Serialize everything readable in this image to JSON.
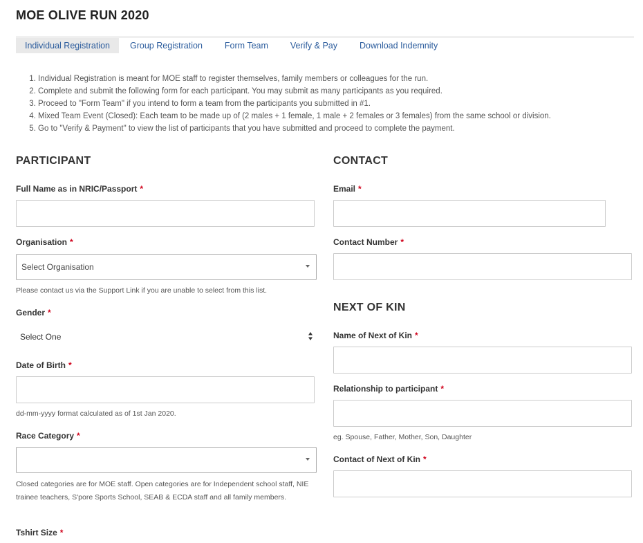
{
  "header": {
    "title": "MOE OLIVE RUN 2020"
  },
  "tabs": [
    {
      "label": "Individual Registration",
      "active": true
    },
    {
      "label": "Group Registration",
      "active": false
    },
    {
      "label": "Form Team",
      "active": false
    },
    {
      "label": "Verify & Pay",
      "active": false
    },
    {
      "label": "Download Indemnity",
      "active": false
    }
  ],
  "instructions": [
    "Individual Registration is meant for MOE staff to register themselves, family members or colleagues for the run.",
    "Complete and submit the following form for each participant. You may submit as many participants as you required.",
    "Proceed to \"Form Team\" if you intend to form a team from the participants you submitted in #1.",
    "Mixed Team Event (Closed): Each team to be made up of (2 males + 1 female, 1 male + 2 females or 3 females) from the same school or division.",
    "Go to \"Verify & Payment\" to view the list of participants that you have submitted  and proceed to complete the payment."
  ],
  "participant": {
    "title": "PARTICIPANT",
    "full_name_label": "Full Name as in NRIC/Passport",
    "organisation_label": "Organisation",
    "organisation_value": "Select Organisation",
    "organisation_hint": "Please contact us via the Support Link if you are unable to select from this list.",
    "gender_label": "Gender",
    "gender_value": "Select One",
    "dob_label": "Date of Birth",
    "dob_hint": "dd-mm-yyyy format calculated as of 1st Jan 2020.",
    "race_label": "Race Category",
    "race_value": "",
    "race_hint": "Closed categories are for MOE staff. Open categories are for Independent school staff, NIE trainee teachers, S'pore Sports School, SEAB & ECDA staff and all family members.",
    "tshirt_label": "Tshirt Size"
  },
  "contact": {
    "title": "CONTACT",
    "email_label": "Email",
    "phone_label": "Contact Number"
  },
  "next_of_kin": {
    "title": "NEXT OF KIN",
    "name_label": "Name of Next of Kin",
    "relationship_label": "Relationship to participant",
    "relationship_hint": "eg. Spouse, Father, Mother, Son, Daughter",
    "contact_label": "Contact of Next of Kin"
  },
  "required_marker": "*",
  "colors": {
    "link": "#2a5b9c",
    "required": "#d0021b",
    "active_tab_bg": "#e9e9e9"
  }
}
